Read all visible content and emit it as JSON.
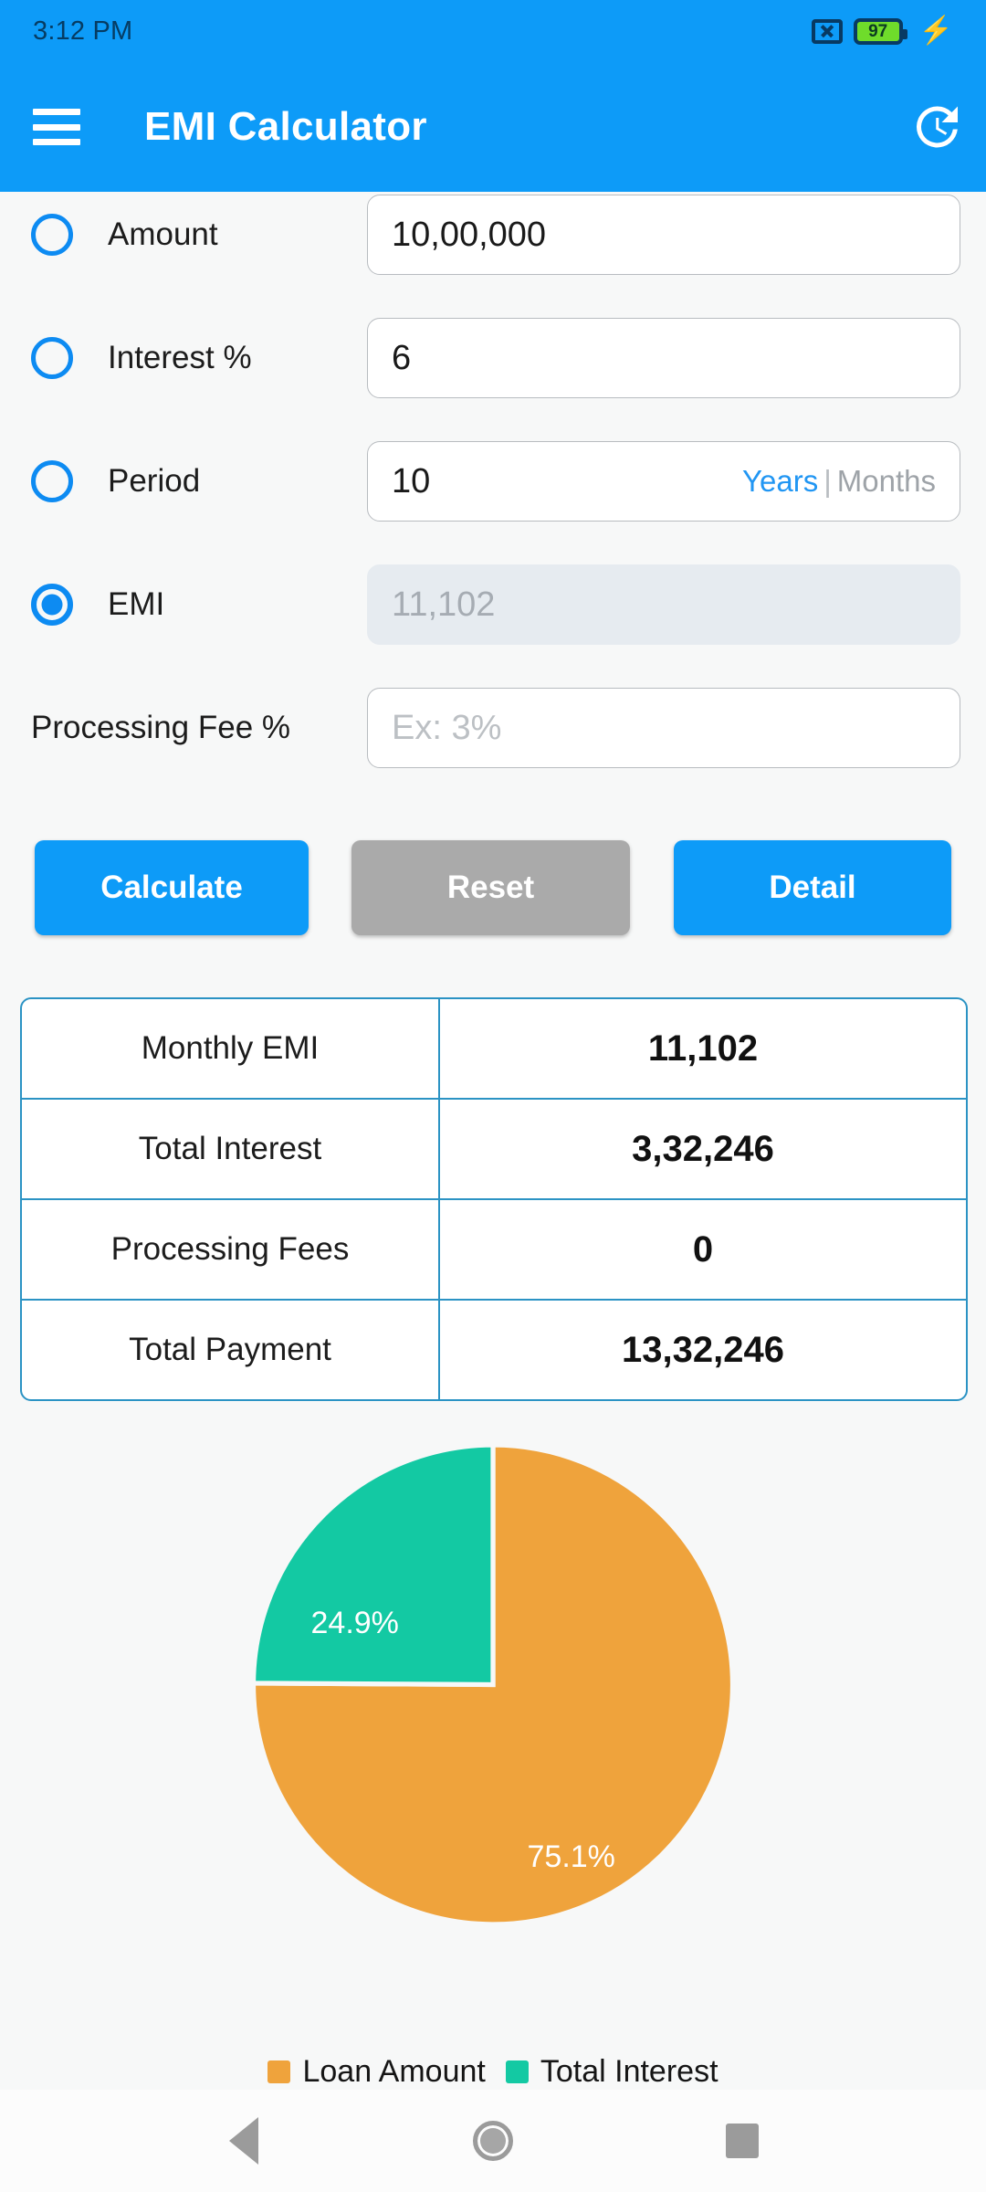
{
  "status_bar": {
    "time": "3:12 PM",
    "nosim_icon": "no-sim-icon",
    "battery_level": "97",
    "charging_icon": "lightning-bolt-icon"
  },
  "app_bar": {
    "menu_icon": "hamburger-menu-icon",
    "title": "EMI Calculator",
    "history_icon": "history-icon"
  },
  "form": {
    "rows": [
      {
        "label": "Amount",
        "value": "10,00,000",
        "selected": false,
        "disabled": false
      },
      {
        "label": "Interest %",
        "value": "6",
        "selected": false,
        "disabled": false
      },
      {
        "label": "Period",
        "value": "10",
        "selected": false,
        "disabled": false,
        "unit_active": "Years",
        "unit_separator": "|",
        "unit_inactive": "Months"
      },
      {
        "label": "EMI",
        "value": "11,102",
        "selected": true,
        "disabled": true
      }
    ],
    "processing_fee": {
      "label": "Processing Fee %",
      "value": "",
      "placeholder": "Ex: 3%"
    }
  },
  "buttons": {
    "calculate": "Calculate",
    "reset": "Reset",
    "detail": "Detail"
  },
  "results": {
    "rows": [
      {
        "label": "Monthly EMI",
        "value": "11,102"
      },
      {
        "label": "Total Interest",
        "value": "3,32,246"
      },
      {
        "label": "Processing Fees",
        "value": "0"
      },
      {
        "label": "Total Payment",
        "value": "13,32,246"
      }
    ]
  },
  "chart_data": {
    "type": "pie",
    "title": "",
    "categories": [
      "Loan Amount",
      "Total Interest"
    ],
    "values": [
      1000000,
      332246
    ],
    "percentages": [
      75.1,
      24.9
    ],
    "labels": [
      "75.1%",
      "24.9%"
    ],
    "colors": [
      "#efa33c",
      "#13c9a3"
    ],
    "legend_position": "bottom",
    "start_angle_deg": 0,
    "direction": "clockwise",
    "label_color": "#ffffff"
  },
  "legend": {
    "items": [
      {
        "label": "Loan Amount",
        "color": "#efa33c"
      },
      {
        "label": "Total Interest",
        "color": "#13c9a3"
      }
    ]
  },
  "nav_bar": {
    "back": "back-icon",
    "home": "home-icon",
    "recents": "recents-icon"
  },
  "colors": {
    "accent": "#0d9bf8",
    "radio": "#0d8bf2",
    "table_border": "#2b93c4",
    "reset_gray": "#aaaaaa",
    "orange": "#efa33c",
    "teal": "#13c9a3"
  }
}
